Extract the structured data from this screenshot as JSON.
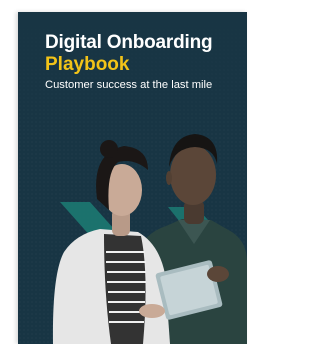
{
  "cover": {
    "title_line1": "Digital Onboarding",
    "title_line2": "Playbook",
    "subtitle": "Customer success at the last mile"
  },
  "colors": {
    "background": "#183544",
    "accent": "#f2c318",
    "title": "#ffffff",
    "arrows": "#1c7c74"
  }
}
